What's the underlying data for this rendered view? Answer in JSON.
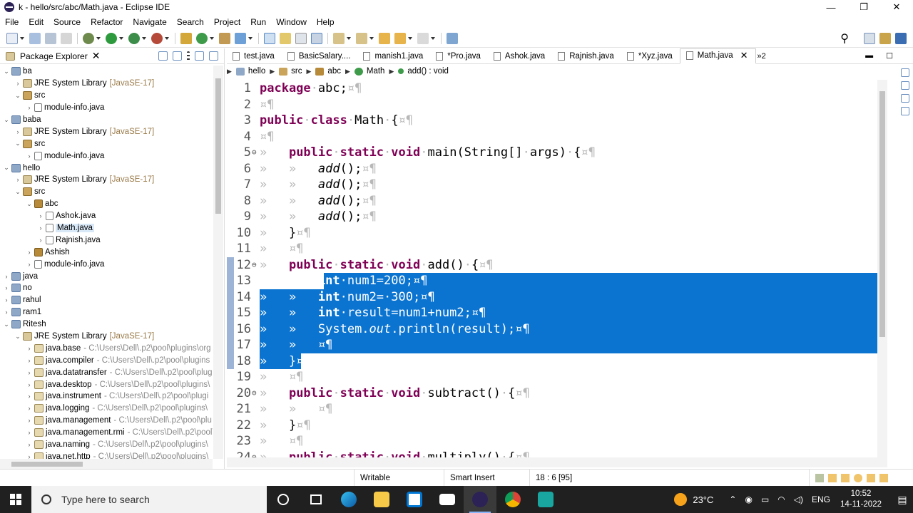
{
  "window": {
    "title": "k - hello/src/abc/Math.java - Eclipse IDE",
    "controls": [
      "—",
      "❐",
      "✕"
    ]
  },
  "menu": [
    "File",
    "Edit",
    "Source",
    "Refactor",
    "Navigate",
    "Search",
    "Project",
    "Run",
    "Window",
    "Help"
  ],
  "package_explorer": {
    "title": "Package Explorer",
    "tree": [
      {
        "depth": 0,
        "toggle": "⌄",
        "icon": "proj",
        "label": "ba"
      },
      {
        "depth": 1,
        "toggle": "›",
        "icon": "lib",
        "label": "JRE System Library",
        "extra": "[JavaSE-17]"
      },
      {
        "depth": 1,
        "toggle": "⌄",
        "icon": "src",
        "label": "src"
      },
      {
        "depth": 2,
        "toggle": "›",
        "icon": "file",
        "label": "module-info.java"
      },
      {
        "depth": 0,
        "toggle": "⌄",
        "icon": "proj",
        "label": "baba"
      },
      {
        "depth": 1,
        "toggle": "›",
        "icon": "lib",
        "label": "JRE System Library",
        "extra": "[JavaSE-17]"
      },
      {
        "depth": 1,
        "toggle": "⌄",
        "icon": "src",
        "label": "src"
      },
      {
        "depth": 2,
        "toggle": "›",
        "icon": "file",
        "label": "module-info.java"
      },
      {
        "depth": 0,
        "toggle": "⌄",
        "icon": "proj",
        "label": "hello"
      },
      {
        "depth": 1,
        "toggle": "›",
        "icon": "lib",
        "label": "JRE System Library",
        "extra": "[JavaSE-17]"
      },
      {
        "depth": 1,
        "toggle": "⌄",
        "icon": "src",
        "label": "src"
      },
      {
        "depth": 2,
        "toggle": "⌄",
        "icon": "pkg",
        "label": "abc"
      },
      {
        "depth": 3,
        "toggle": "›",
        "icon": "file",
        "label": "Ashok.java"
      },
      {
        "depth": 3,
        "toggle": "›",
        "icon": "file",
        "label": "Math.java",
        "selected": true
      },
      {
        "depth": 3,
        "toggle": "›",
        "icon": "file",
        "label": "Rajnish.java"
      },
      {
        "depth": 2,
        "toggle": "›",
        "icon": "pkg",
        "label": "Ashish"
      },
      {
        "depth": 2,
        "toggle": "›",
        "icon": "file",
        "label": "module-info.java"
      },
      {
        "depth": 0,
        "toggle": "›",
        "icon": "proj",
        "label": "java"
      },
      {
        "depth": 0,
        "toggle": "›",
        "icon": "proj",
        "label": "no"
      },
      {
        "depth": 0,
        "toggle": "›",
        "icon": "proj",
        "label": "rahul"
      },
      {
        "depth": 0,
        "toggle": "›",
        "icon": "proj",
        "label": "ram1"
      },
      {
        "depth": 0,
        "toggle": "⌄",
        "icon": "proj",
        "label": "Ritesh"
      },
      {
        "depth": 1,
        "toggle": "⌄",
        "icon": "lib",
        "label": "JRE System Library",
        "extra": "[JavaSE-17]"
      },
      {
        "depth": 2,
        "toggle": "›",
        "icon": "jar",
        "label": "java.base",
        "path": "- C:\\Users\\Dell\\.p2\\pool\\plugins\\org"
      },
      {
        "depth": 2,
        "toggle": "›",
        "icon": "jar",
        "label": "java.compiler",
        "path": "- C:\\Users\\Dell\\.p2\\pool\\plugins"
      },
      {
        "depth": 2,
        "toggle": "›",
        "icon": "jar",
        "label": "java.datatransfer",
        "path": "- C:\\Users\\Dell\\.p2\\pool\\plug"
      },
      {
        "depth": 2,
        "toggle": "›",
        "icon": "jar",
        "label": "java.desktop",
        "path": "- C:\\Users\\Dell\\.p2\\pool\\plugins\\"
      },
      {
        "depth": 2,
        "toggle": "›",
        "icon": "jar",
        "label": "java.instrument",
        "path": "- C:\\Users\\Dell\\.p2\\pool\\plugi"
      },
      {
        "depth": 2,
        "toggle": "›",
        "icon": "jar",
        "label": "java.logging",
        "path": "- C:\\Users\\Dell\\.p2\\pool\\plugins\\"
      },
      {
        "depth": 2,
        "toggle": "›",
        "icon": "jar",
        "label": "java.management",
        "path": "- C:\\Users\\Dell\\.p2\\pool\\plu"
      },
      {
        "depth": 2,
        "toggle": "›",
        "icon": "jar",
        "label": "java.management.rmi",
        "path": "- C:\\Users\\Dell\\.p2\\pool\\"
      },
      {
        "depth": 2,
        "toggle": "›",
        "icon": "jar",
        "label": "java.naming",
        "path": "- C:\\Users\\Dell\\.p2\\pool\\plugins\\"
      },
      {
        "depth": 2,
        "toggle": "›",
        "icon": "jar",
        "label": "java.net.http",
        "path": "- C:\\Users\\Dell\\.p2\\pool\\plugins\\"
      }
    ]
  },
  "editor_tabs": [
    {
      "label": "test.java",
      "active": false
    },
    {
      "label": "BasicSalary....",
      "active": false
    },
    {
      "label": "manish1.java",
      "active": false
    },
    {
      "label": "*Pro.java",
      "active": false
    },
    {
      "label": "Ashok.java",
      "active": false
    },
    {
      "label": "Rajnish.java",
      "active": false
    },
    {
      "label": "*Xyz.java",
      "active": false
    },
    {
      "label": "Math.java",
      "active": true
    }
  ],
  "tabs_overflow": "»2",
  "breadcrumb": [
    "hello",
    "src",
    "abc",
    "Math",
    "add() : void"
  ],
  "code_lines": [
    {
      "n": "1",
      "fold": "",
      "html": "<span class=\"kw\">package</span><span class=\"ws\">·</span>abc;<span class=\"ws\">¤¶</span>"
    },
    {
      "n": "2",
      "fold": "",
      "html": "<span class=\"ws\">¤¶</span>"
    },
    {
      "n": "3",
      "fold": "",
      "html": "<span class=\"kw\">public</span><span class=\"ws\">·</span><span class=\"kw\">class</span><span class=\"ws\">·</span>Math<span class=\"ws\">·</span>{<span class=\"ws\">¤¶</span>"
    },
    {
      "n": "4",
      "fold": "",
      "html": "<span class=\"ws\">¤¶</span>"
    },
    {
      "n": "5",
      "fold": "⊖",
      "html": "<span class=\"ws\">»   </span><span class=\"kw\">public</span><span class=\"ws\">·</span><span class=\"kw\">static</span><span class=\"ws\">·</span><span class=\"kw\">void</span><span class=\"ws\">·</span>main(String[]<span class=\"ws\">·</span>args)<span class=\"ws\">·</span>{<span class=\"ws\">¤¶</span>"
    },
    {
      "n": "6",
      "fold": "",
      "html": "<span class=\"ws\">»   »   </span><span class=\"it\">add</span>();<span class=\"ws\">¤¶</span>"
    },
    {
      "n": "7",
      "fold": "",
      "html": "<span class=\"ws\">»   »   </span><span class=\"it\">add</span>();<span class=\"ws\">¤¶</span>"
    },
    {
      "n": "8",
      "fold": "",
      "html": "<span class=\"ws\">»   »   </span><span class=\"it\">add</span>();<span class=\"ws\">¤¶</span>"
    },
    {
      "n": "9",
      "fold": "",
      "html": "<span class=\"ws\">»   »   </span><span class=\"it\">add</span>();<span class=\"ws\">¤¶</span>"
    },
    {
      "n": "10",
      "fold": "",
      "html": "<span class=\"ws\">»   </span>}<span class=\"ws\">¤¶</span>"
    },
    {
      "n": "11",
      "fold": "",
      "html": "<span class=\"ws\">»   ¤¶</span>"
    },
    {
      "n": "12",
      "fold": "⊖",
      "html": "<span class=\"ws\">»   </span><span class=\"kw\">public</span><span class=\"ws\">·</span><span class=\"kw\">static</span><span class=\"ws\">·</span><span class=\"kw\">void</span><span class=\"ws\">·</span>add()<span class=\"ws\">·</span>{<span class=\"ws\">¤¶</span>"
    },
    {
      "n": "13",
      "fold": "",
      "html": "<span class=\"ws\">»   »   </span><span class=\"kw\">int</span><span class=\"ws\">·</span>num1=200;<span class=\"ws\">¤¶</span>"
    },
    {
      "n": "14",
      "fold": "",
      "html": "<span class=\"ws\">»   »   </span><span class=\"kw\">int</span><span class=\"ws\">·</span>num2=<span class=\"ws\">·</span>300;<span class=\"ws\">¤¶</span>"
    },
    {
      "n": "15",
      "fold": "",
      "html": "<span class=\"ws\">»   »   </span><span class=\"kw\">int</span><span class=\"ws\">·</span>result=num1+num2;<span class=\"ws\">¤¶</span>"
    },
    {
      "n": "16",
      "fold": "",
      "html": "<span class=\"ws\">»   »   </span>System.<span class=\"sf\">out</span>.println(result);<span class=\"ws\">¤¶</span>"
    },
    {
      "n": "17",
      "fold": "",
      "html": "<span class=\"ws\">»   »   ¤¶</span>"
    },
    {
      "n": "18",
      "fold": "",
      "html": "<span class=\"ws\">»   </span>}<span class=\"ws\">¤¶</span>"
    },
    {
      "n": "19",
      "fold": "",
      "html": "<span class=\"ws\">»   ¤¶</span>"
    },
    {
      "n": "20",
      "fold": "⊖",
      "html": "<span class=\"ws\">»   </span><span class=\"kw\">public</span><span class=\"ws\">·</span><span class=\"kw\">static</span><span class=\"ws\">·</span><span class=\"kw\">void</span><span class=\"ws\">·</span>subtract()<span class=\"ws\">·</span>{<span class=\"ws\">¤¶</span>"
    },
    {
      "n": "21",
      "fold": "",
      "html": "<span class=\"ws\">»   »   ¤¶</span>"
    },
    {
      "n": "22",
      "fold": "",
      "html": "<span class=\"ws\">»   </span>}<span class=\"ws\">¤¶</span>"
    },
    {
      "n": "23",
      "fold": "",
      "html": "<span class=\"ws\">»   ¤¶</span>"
    },
    {
      "n": "24",
      "fold": "⊖",
      "html": "<span class=\"ws\">»   </span><span class=\"kw\">public</span><span class=\"ws\">·</span><span class=\"kw\">static</span><span class=\"ws\">·</span><span class=\"kw\">void</span><span class=\"ws\">·</span>multiply()<span class=\"ws\">·</span>{<span class=\"ws\">¤¶</span>"
    }
  ],
  "selection": {
    "from_line": 13,
    "to_line": 18
  },
  "status": {
    "mode": "Writable",
    "insert": "Smart Insert",
    "position": "18 : 6 [95]"
  },
  "taskbar": {
    "search_placeholder": "Type here to search",
    "weather": "23°C",
    "lang": "ENG",
    "time": "10:52",
    "date": "14-11-2022"
  },
  "colors": {
    "keyword": "#7f0055",
    "selection": "#0b74d1",
    "static_field": "#0000c0"
  }
}
